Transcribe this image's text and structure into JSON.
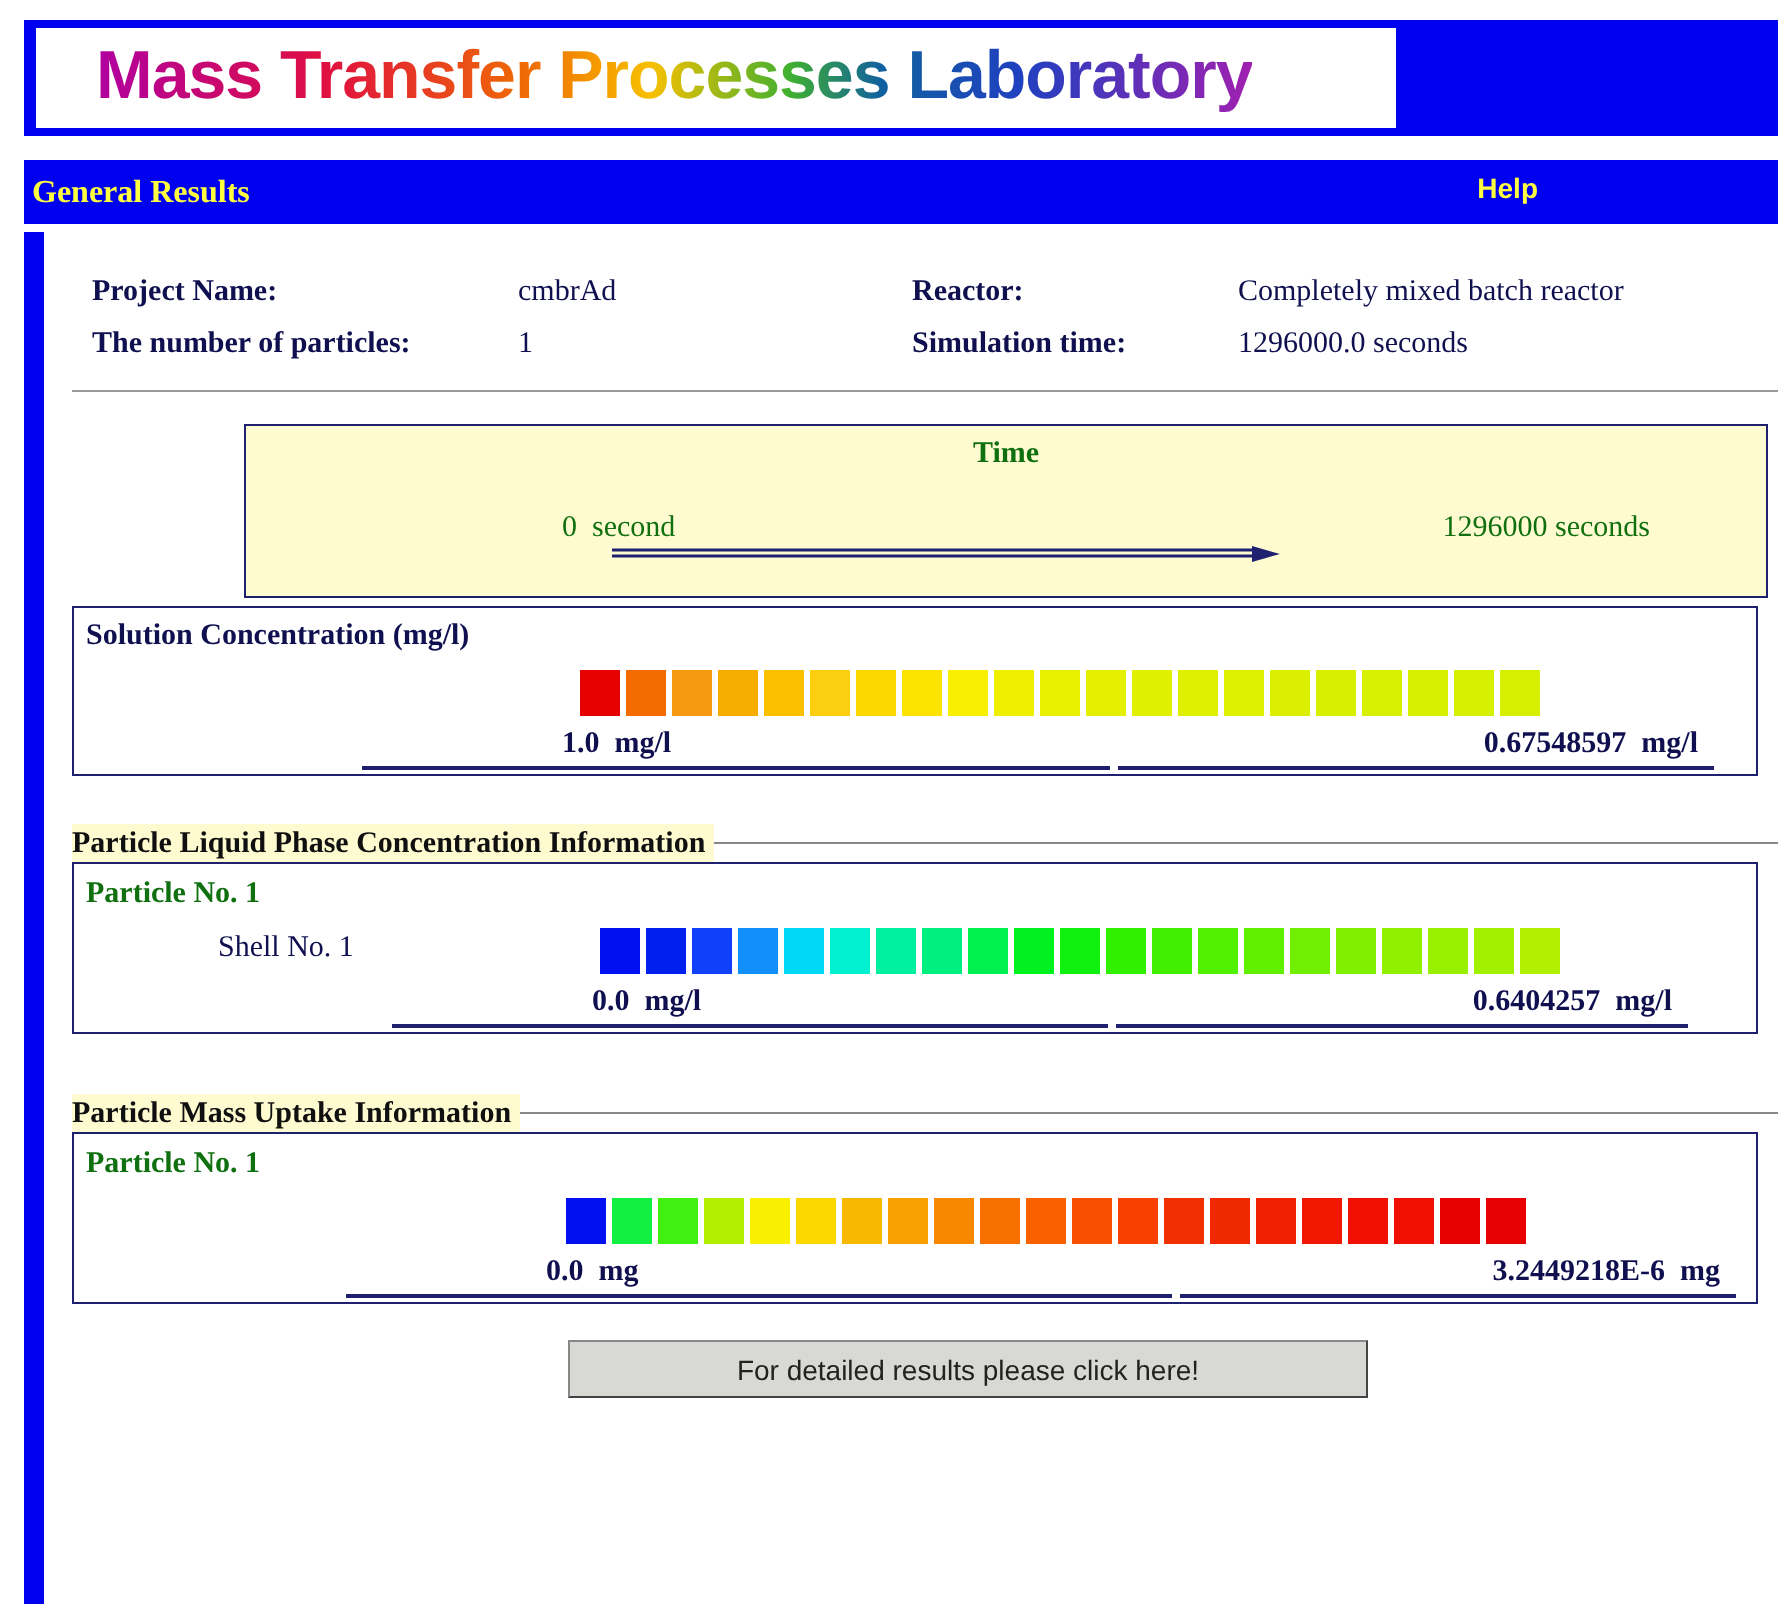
{
  "logo": {
    "title": "Mass Transfer Processes Laboratory"
  },
  "navbar": {
    "title": "General Results",
    "help": "Help"
  },
  "summary": [
    {
      "label": "Project Name:",
      "value": "cmbrAd"
    },
    {
      "label": "Reactor:",
      "value": "Completely mixed batch reactor"
    },
    {
      "label": "The number of particles:",
      "value": "1"
    },
    {
      "label": "Simulation time:",
      "value": "1296000.0 seconds"
    }
  ],
  "time": {
    "title": "Time",
    "start": "0  second",
    "end": "1296000 seconds"
  },
  "solution": {
    "title": "Solution Concentration (mg/l)",
    "min": "1.0  mg/l",
    "max": "0.67548597  mg/l",
    "squares": [
      {
        "color": "#e60000"
      },
      {
        "color": "#f26a00"
      },
      {
        "color": "#f59a10"
      },
      {
        "color": "#f8ae00"
      },
      {
        "color": "#fbc000"
      },
      {
        "color": "#fcce10"
      },
      {
        "color": "#fdd800"
      },
      {
        "color": "#fce400"
      },
      {
        "color": "#f8f000"
      },
      {
        "color": "#eef000"
      },
      {
        "color": "#e8f000"
      },
      {
        "color": "#e4f000"
      },
      {
        "color": "#e0f000"
      },
      {
        "color": "#def000"
      },
      {
        "color": "#dcf000"
      },
      {
        "color": "#daf000"
      },
      {
        "color": "#d8f000"
      },
      {
        "color": "#d8f002"
      },
      {
        "color": "#d6f000"
      },
      {
        "color": "#d6f002"
      },
      {
        "color": "#d4f000"
      }
    ]
  },
  "liquid_phase": {
    "title": "Particle Liquid Phase Concentration  Information",
    "particle": "Particle No. 1",
    "shell": "Shell No. 1",
    "min": "0.0  mg/l",
    "max": "0.6404257  mg/l",
    "squares": [
      {
        "color": "#0010f0"
      },
      {
        "color": "#0020f0"
      },
      {
        "color": "#1040f8"
      },
      {
        "color": "#1090f8"
      },
      {
        "color": "#00d8f8"
      },
      {
        "color": "#00f0d0"
      },
      {
        "color": "#00f0a0"
      },
      {
        "color": "#00f080"
      },
      {
        "color": "#00f050"
      },
      {
        "color": "#00f020"
      },
      {
        "color": "#10f010"
      },
      {
        "color": "#30f000"
      },
      {
        "color": "#40f000"
      },
      {
        "color": "#50f000"
      },
      {
        "color": "#60f000"
      },
      {
        "color": "#70f000"
      },
      {
        "color": "#80f000"
      },
      {
        "color": "#90f000"
      },
      {
        "color": "#98f000"
      },
      {
        "color": "#a0f000"
      },
      {
        "color": "#b0f000"
      }
    ]
  },
  "mass_uptake": {
    "title": "Particle Mass Uptake  Information",
    "particle": "Particle No. 1",
    "min": "0.0  mg",
    "max": "3.2449218E-6  mg",
    "squares": [
      {
        "color": "#0010f0"
      },
      {
        "color": "#10f040"
      },
      {
        "color": "#40f010"
      },
      {
        "color": "#b0f000"
      },
      {
        "color": "#f8f000"
      },
      {
        "color": "#fcd800"
      },
      {
        "color": "#f8b800"
      },
      {
        "color": "#f8a000"
      },
      {
        "color": "#f88800"
      },
      {
        "color": "#f87000"
      },
      {
        "color": "#f86000"
      },
      {
        "color": "#f85000"
      },
      {
        "color": "#f84000"
      },
      {
        "color": "#f03000"
      },
      {
        "color": "#f02800"
      },
      {
        "color": "#f02000"
      },
      {
        "color": "#f01800"
      },
      {
        "color": "#f01000"
      },
      {
        "color": "#f01002"
      },
      {
        "color": "#e80000"
      },
      {
        "color": "#e80002"
      }
    ]
  },
  "detail_button": "For detailed results please click here!"
}
